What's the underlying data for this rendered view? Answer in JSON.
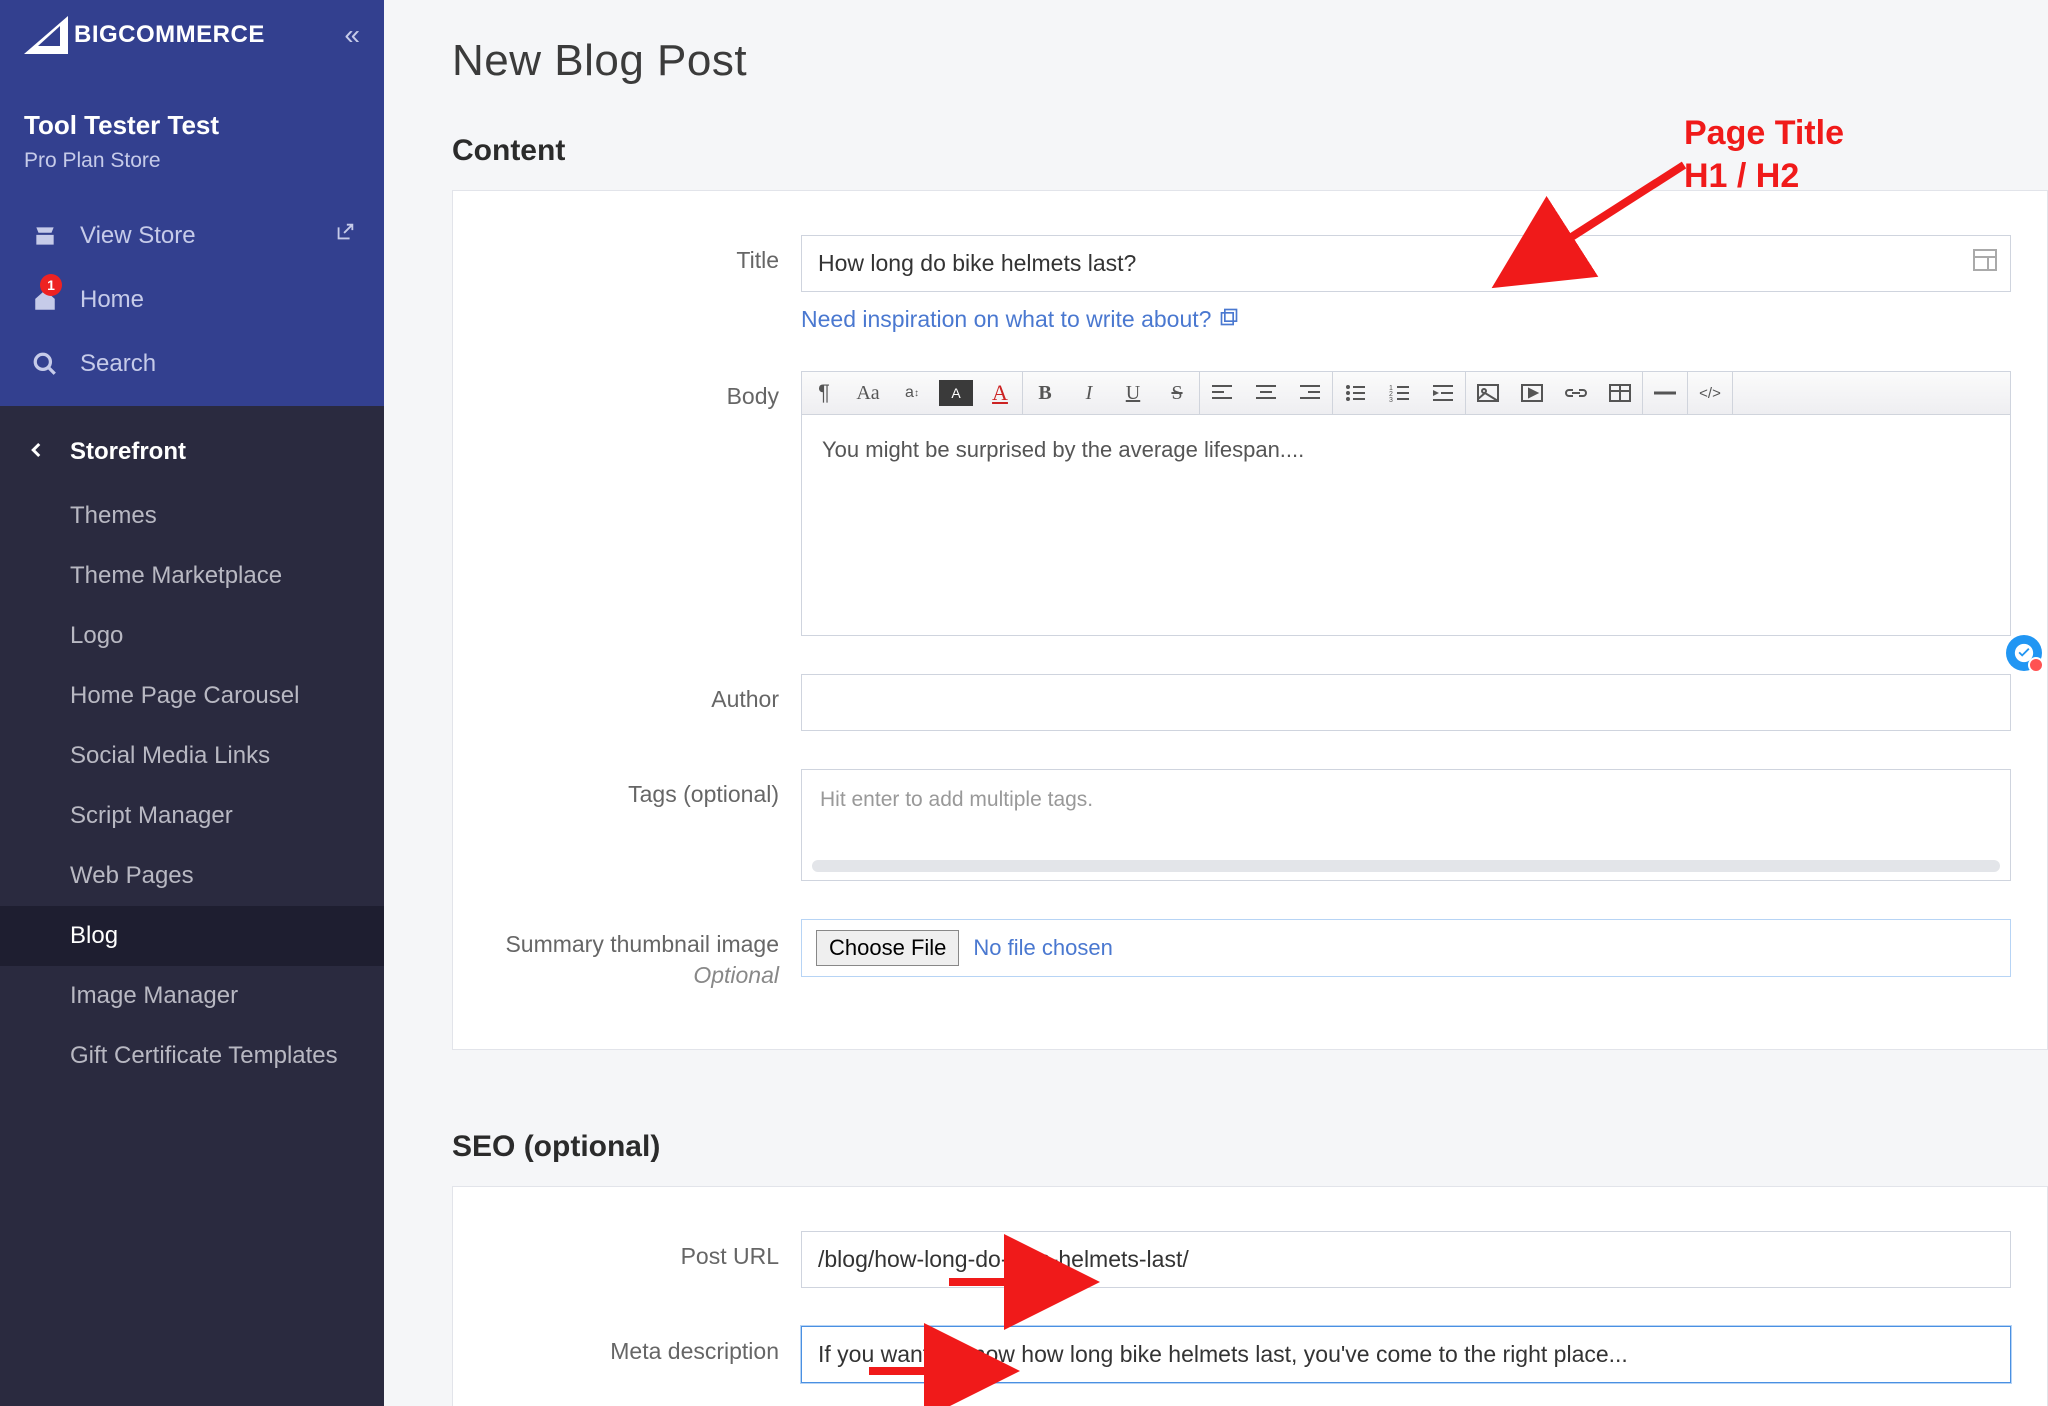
{
  "brand": {
    "name": "BIGCOMMERCE"
  },
  "store": {
    "name": "Tool Tester Test",
    "plan": "Pro Plan Store"
  },
  "nav": {
    "view_store": "View Store",
    "home": "Home",
    "home_badge": "1",
    "search": "Search"
  },
  "submenu": {
    "header": "Storefront",
    "items": [
      "Themes",
      "Theme Marketplace",
      "Logo",
      "Home Page Carousel",
      "Social Media Links",
      "Script Manager",
      "Web Pages",
      "Blog",
      "Image Manager",
      "Gift Certificate Templates"
    ],
    "active_index": 7
  },
  "page": {
    "title": "New Blog Post"
  },
  "content": {
    "section_title": "Content",
    "labels": {
      "title": "Title",
      "body": "Body",
      "author": "Author",
      "tags": "Tags (optional)",
      "thumb": "Summary thumbnail image",
      "thumb_sub": "Optional"
    },
    "title_value": "How long do bike helmets last?",
    "inspiration_link": "Need inspiration on what to write about?",
    "body_value": "You might be surprised by the average lifespan....",
    "author_value": "",
    "tags_placeholder": "Hit enter to add multiple tags.",
    "file_button": "Choose File",
    "file_status": "No file chosen"
  },
  "seo": {
    "section_title": "SEO (optional)",
    "labels": {
      "url": "Post URL",
      "meta": "Meta description"
    },
    "url_value": "/blog/how-long-do-bike-helmets-last/",
    "meta_value": "If you want to know how long bike helmets last, you've come to the right place..."
  },
  "annotations": {
    "title": "Page Title\nH1 / H2"
  },
  "toolbar_icons": [
    "¶",
    "Aa",
    "aꜛ",
    "A",
    "A",
    "B",
    "I",
    "U",
    "S",
    "≡",
    "≡",
    "≡",
    "•",
    "≡",
    "≡",
    "▦",
    "▶",
    "🔗",
    "▭",
    "—",
    "</>"
  ]
}
